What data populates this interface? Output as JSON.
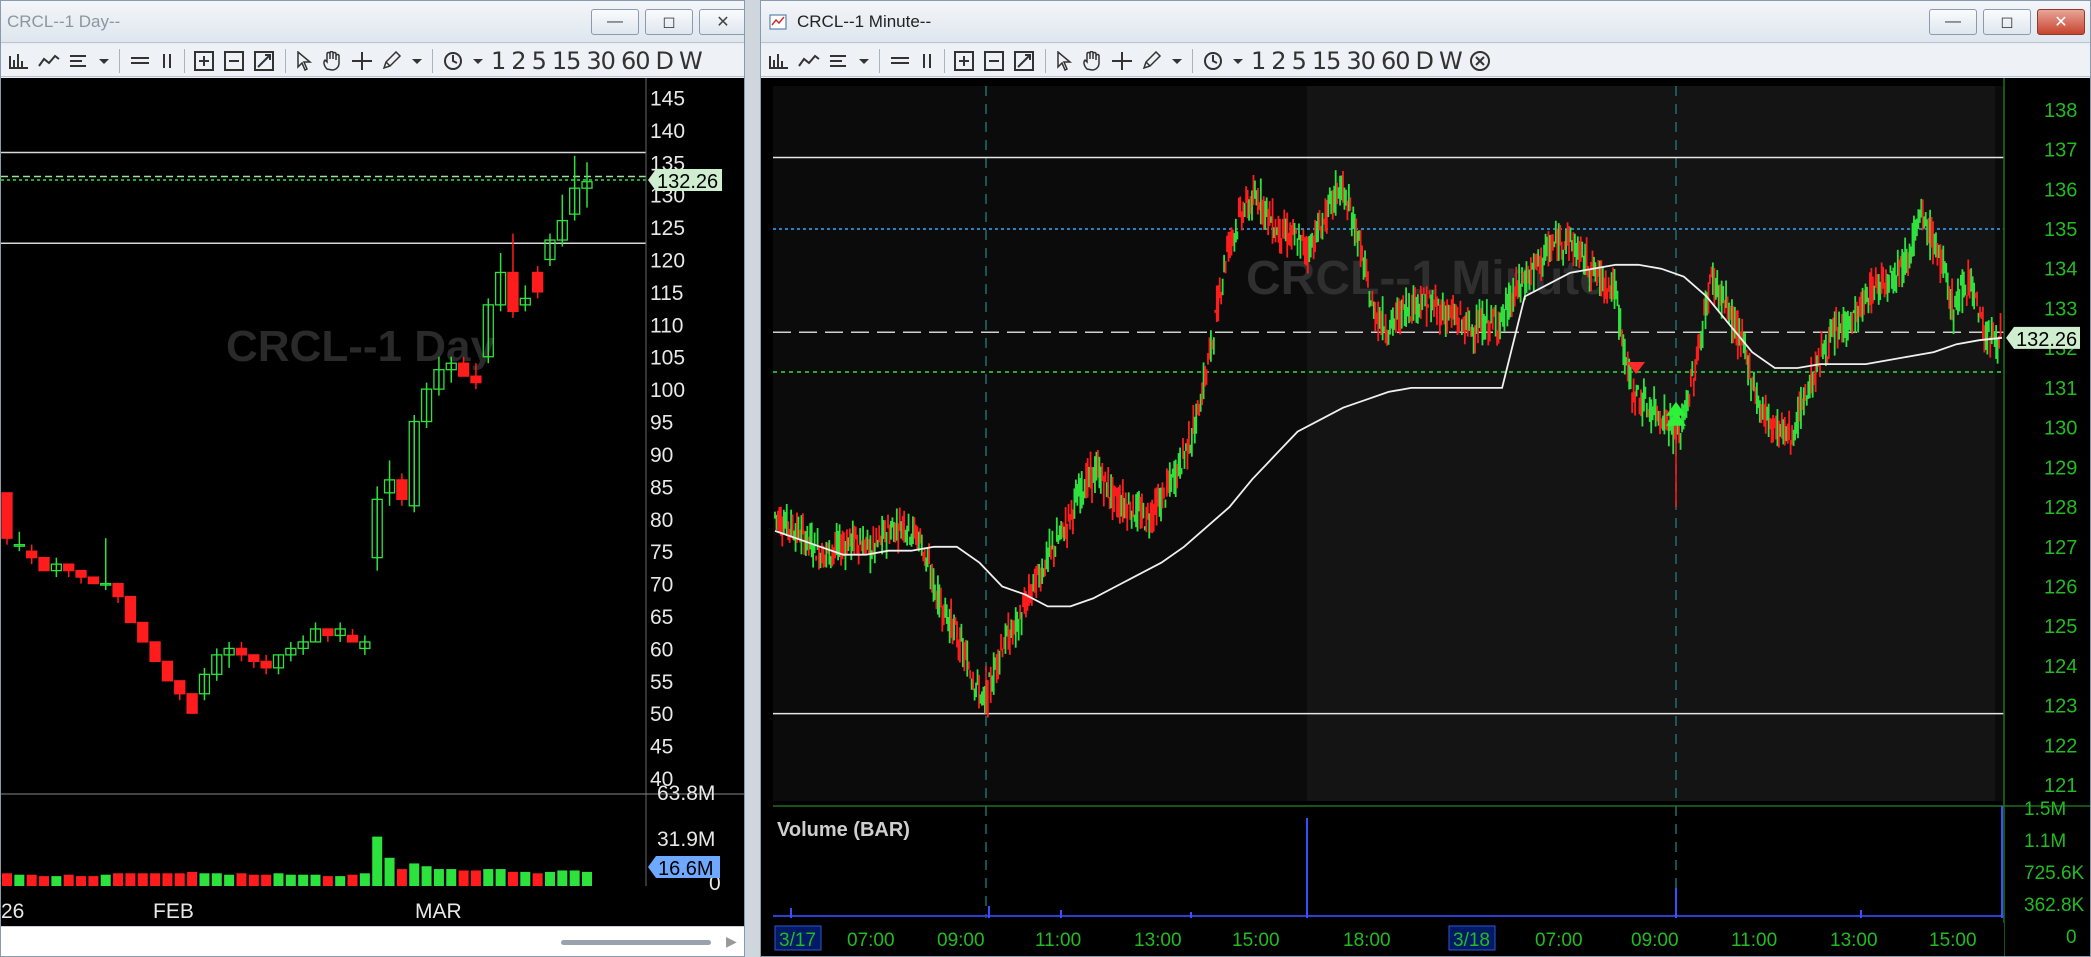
{
  "left_window": {
    "title": "CRCL--1 Day--",
    "watermark": "CRCL--1 Day",
    "toolbar": [
      "1",
      "2",
      "5",
      "15",
      "30",
      "60",
      "D",
      "W"
    ],
    "price_label": "132.26",
    "price_axis": [
      "145",
      "140",
      "135",
      "130",
      "125",
      "120",
      "115",
      "110",
      "105",
      "100",
      "95",
      "90",
      "85",
      "80",
      "75",
      "70",
      "65",
      "60",
      "55",
      "50",
      "45",
      "40"
    ],
    "volume_axis": [
      "63.8M",
      "31.9M",
      "0"
    ],
    "volume_label": "16.6M",
    "x_labels": [
      "26",
      "FEB",
      "MAR"
    ]
  },
  "right_window": {
    "title": "CRCL--1 Minute--",
    "watermark": "CRCL--1 Minute",
    "toolbar": [
      "1",
      "2",
      "5",
      "15",
      "30",
      "60",
      "D",
      "W"
    ],
    "price_label": "132.26",
    "price_axis": [
      "138",
      "137",
      "136",
      "135",
      "134",
      "133",
      "132",
      "131",
      "130",
      "129",
      "128",
      "127",
      "126",
      "125",
      "124",
      "123",
      "122",
      "121"
    ],
    "volume_title": "Volume (BAR)",
    "volume_axis": [
      "1.5M",
      "1.1M",
      "725.6K",
      "362.8K",
      "0"
    ],
    "x_labels": [
      "3/17",
      "07:00",
      "09:00",
      "11:00",
      "13:00",
      "15:00",
      "18:00",
      "3/18",
      "07:00",
      "09:00",
      "11:00",
      "13:00",
      "15:00"
    ]
  },
  "colors": {
    "up": "#2ee23e",
    "down": "#ff1c1c",
    "axis": "#22bb22",
    "accent_label": "#cfeecf",
    "volume_label": "#6fa8ff"
  },
  "chart_data": [
    {
      "type": "candlestick",
      "series": [
        {
          "values": [
            {
              "o": 84,
              "h": 84,
              "l": 76,
              "c": 77
            },
            {
              "o": 76,
              "h": 78,
              "l": 75,
              "c": 76
            },
            {
              "o": 75,
              "h": 76,
              "l": 73,
              "c": 74
            },
            {
              "o": 74,
              "h": 74,
              "l": 72,
              "c": 72
            },
            {
              "o": 72,
              "h": 74,
              "l": 71,
              "c": 73
            },
            {
              "o": 73,
              "h": 73,
              "l": 71,
              "c": 72
            },
            {
              "o": 72,
              "h": 72,
              "l": 70,
              "c": 71
            },
            {
              "o": 71,
              "h": 71,
              "l": 70,
              "c": 70
            },
            {
              "o": 70,
              "h": 77,
              "l": 69,
              "c": 70
            },
            {
              "o": 70,
              "h": 70,
              "l": 67,
              "c": 68
            },
            {
              "o": 68,
              "h": 68,
              "l": 64,
              "c": 64
            },
            {
              "o": 64,
              "h": 64,
              "l": 61,
              "c": 61
            },
            {
              "o": 61,
              "h": 61,
              "l": 58,
              "c": 58
            },
            {
              "o": 58,
              "h": 58,
              "l": 55,
              "c": 55
            },
            {
              "o": 55,
              "h": 55,
              "l": 52,
              "c": 53
            },
            {
              "o": 53,
              "h": 53,
              "l": 50,
              "c": 50
            },
            {
              "o": 53,
              "h": 57,
              "l": 52,
              "c": 56
            },
            {
              "o": 56,
              "h": 60,
              "l": 55,
              "c": 59
            },
            {
              "o": 59,
              "h": 61,
              "l": 57,
              "c": 60
            },
            {
              "o": 60,
              "h": 61,
              "l": 58,
              "c": 59
            },
            {
              "o": 59,
              "h": 59,
              "l": 57,
              "c": 58
            },
            {
              "o": 58,
              "h": 59,
              "l": 56,
              "c": 57
            },
            {
              "o": 57,
              "h": 59,
              "l": 56,
              "c": 59
            },
            {
              "o": 59,
              "h": 61,
              "l": 58,
              "c": 60
            },
            {
              "o": 60,
              "h": 62,
              "l": 59,
              "c": 61
            },
            {
              "o": 61,
              "h": 64,
              "l": 61,
              "c": 63
            },
            {
              "o": 63,
              "h": 63,
              "l": 61,
              "c": 62
            },
            {
              "o": 62,
              "h": 64,
              "l": 61,
              "c": 63
            },
            {
              "o": 62,
              "h": 63,
              "l": 61,
              "c": 61
            },
            {
              "o": 60,
              "h": 62,
              "l": 59,
              "c": 61
            },
            {
              "o": 74,
              "h": 85,
              "l": 72,
              "c": 83
            },
            {
              "o": 84,
              "h": 89,
              "l": 82,
              "c": 86
            },
            {
              "o": 86,
              "h": 87,
              "l": 82,
              "c": 83
            },
            {
              "o": 82,
              "h": 96,
              "l": 81,
              "c": 95
            },
            {
              "o": 95,
              "h": 101,
              "l": 94,
              "c": 100
            },
            {
              "o": 100,
              "h": 105,
              "l": 99,
              "c": 103
            },
            {
              "o": 103,
              "h": 105,
              "l": 101,
              "c": 104
            },
            {
              "o": 104,
              "h": 105,
              "l": 102,
              "c": 102
            },
            {
              "o": 102,
              "h": 104,
              "l": 100,
              "c": 101
            },
            {
              "o": 105,
              "h": 114,
              "l": 104,
              "c": 113
            },
            {
              "o": 113,
              "h": 121,
              "l": 112,
              "c": 118
            },
            {
              "o": 118,
              "h": 124,
              "l": 111,
              "c": 112
            },
            {
              "o": 113,
              "h": 116,
              "l": 112,
              "c": 114
            },
            {
              "o": 118,
              "h": 119,
              "l": 114,
              "c": 115
            },
            {
              "o": 120,
              "h": 124,
              "l": 119,
              "c": 123
            },
            {
              "o": 123,
              "h": 130,
              "l": 122,
              "c": 126
            },
            {
              "o": 127,
              "h": 136,
              "l": 126,
              "c": 131
            },
            {
              "o": 131,
              "h": 135,
              "l": 128,
              "c": 132
            }
          ]
        }
      ],
      "volume": [
        9,
        8,
        8,
        7,
        7,
        8,
        7,
        7,
        8,
        9,
        9,
        9,
        9,
        9,
        9,
        10,
        9,
        9,
        8,
        9,
        8,
        8,
        9,
        8,
        8,
        8,
        7,
        7,
        8,
        9,
        35,
        20,
        12,
        16,
        14,
        12,
        12,
        11,
        11,
        12,
        12,
        10,
        10,
        9,
        10,
        11,
        11,
        10
      ],
      "lines": {
        "upper": 136.5,
        "dash_a": 132.8,
        "dash_b": 132.26,
        "lower": 122.5
      },
      "ylim": [
        38,
        148
      ],
      "volume_max": 63.8
    },
    {
      "type": "candlestick",
      "ylim": [
        120.6,
        138.6
      ],
      "lines": {
        "top": 136.8,
        "blue_dot": 135.0,
        "white_dash": 132.4,
        "green_dot": 131.4,
        "bottom": 122.8
      },
      "markers": [
        {
          "type": "sell-arrow",
          "at": 131.2
        },
        {
          "type": "buy-arrow",
          "at": 130.6
        }
      ],
      "price_path": [
        127.8,
        127.5,
        127.2,
        126.8,
        127.0,
        127.2,
        126.9,
        127.4,
        127.6,
        127.2,
        125.8,
        125.0,
        124.0,
        123.0,
        124.5,
        125.0,
        126.0,
        126.8,
        127.5,
        128.5,
        128.9,
        128.2,
        128.0,
        127.7,
        128.2,
        129.0,
        130.0,
        132.0,
        134.5,
        135.5,
        135.8,
        135.0,
        134.8,
        134.5,
        135.2,
        136.1,
        135.0,
        133.0,
        132.5,
        133.0,
        133.2,
        133.0,
        132.8,
        132.5,
        132.6,
        132.7,
        133.5,
        134.0,
        134.5,
        134.8,
        134.3,
        133.8,
        133.5,
        131.0,
        130.5,
        130.3,
        129.8,
        131.5,
        133.8,
        133.0,
        132.0,
        130.5,
        130.0,
        129.8,
        131.0,
        132.0,
        132.5,
        132.8,
        133.5,
        133.8,
        134.2,
        135.3,
        134.5,
        133.0,
        133.8,
        132.3,
        132.26
      ],
      "vwap_path": [
        127.4,
        127.2,
        127.0,
        126.8,
        126.8,
        126.9,
        126.9,
        127.0,
        127.0,
        126.6,
        126.0,
        125.8,
        125.5,
        125.5,
        125.7,
        126.0,
        126.3,
        126.6,
        127.0,
        127.5,
        128.0,
        128.7,
        129.3,
        129.9,
        130.2,
        130.5,
        130.7,
        130.9,
        131.0,
        131.0,
        131.0,
        131.0,
        131.0,
        133.3,
        133.6,
        133.9,
        134.0,
        134.1,
        134.1,
        134.0,
        133.8,
        133.3,
        132.6,
        131.9,
        131.5,
        131.5,
        131.6,
        131.6,
        131.6,
        131.7,
        131.8,
        131.9,
        132.1,
        132.2,
        132.26
      ],
      "volume": "spikes at session open"
    }
  ]
}
